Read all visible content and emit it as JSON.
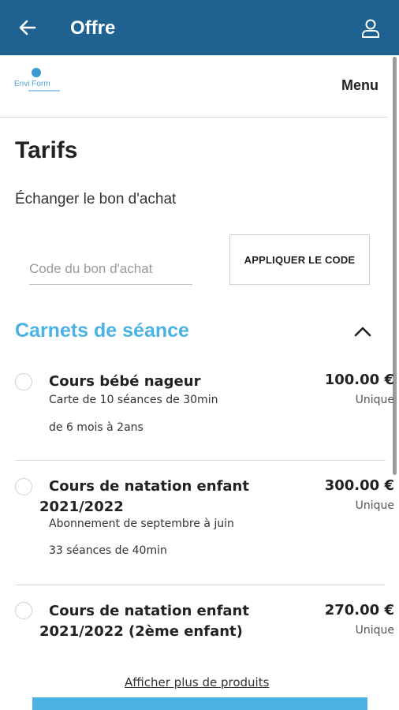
{
  "appbar": {
    "title": "Offre",
    "back_icon": "arrow-left-icon",
    "user_icon": "user-icon"
  },
  "site": {
    "logo_text": "Envi Form",
    "menu_label": "Menu"
  },
  "tarifs": {
    "title": "Tarifs",
    "exchange_label": "Échanger le bon d'achat",
    "code_placeholder": "Code du bon d'achat",
    "apply_label": "APPLIQUER LE CODE"
  },
  "section": {
    "title": "Carnets de séance",
    "expanded": true
  },
  "products": [
    {
      "name_line1": "Cours bébé nageur",
      "name_line2": "",
      "desc": [
        "Carte de 10 séances de 30min",
        "de 6 mois à 2ans"
      ],
      "price": "100.00 €",
      "frequency": "Unique"
    },
    {
      "name_line1": "Cours de natation enfant",
      "name_line2": "2021/2022",
      "desc": [
        "Abonnement de septembre à juin",
        "33 séances de 40min"
      ],
      "price": "300.00 €",
      "frequency": "Unique"
    },
    {
      "name_line1": "Cours de natation enfant",
      "name_line2": "2021/2022 (2ème enfant)",
      "desc": [],
      "price": "270.00 €",
      "frequency": "Unique"
    }
  ],
  "more_link": "Afficher plus de produits",
  "colors": {
    "appbar": "#1f6291",
    "accent": "#4ab3e3"
  }
}
